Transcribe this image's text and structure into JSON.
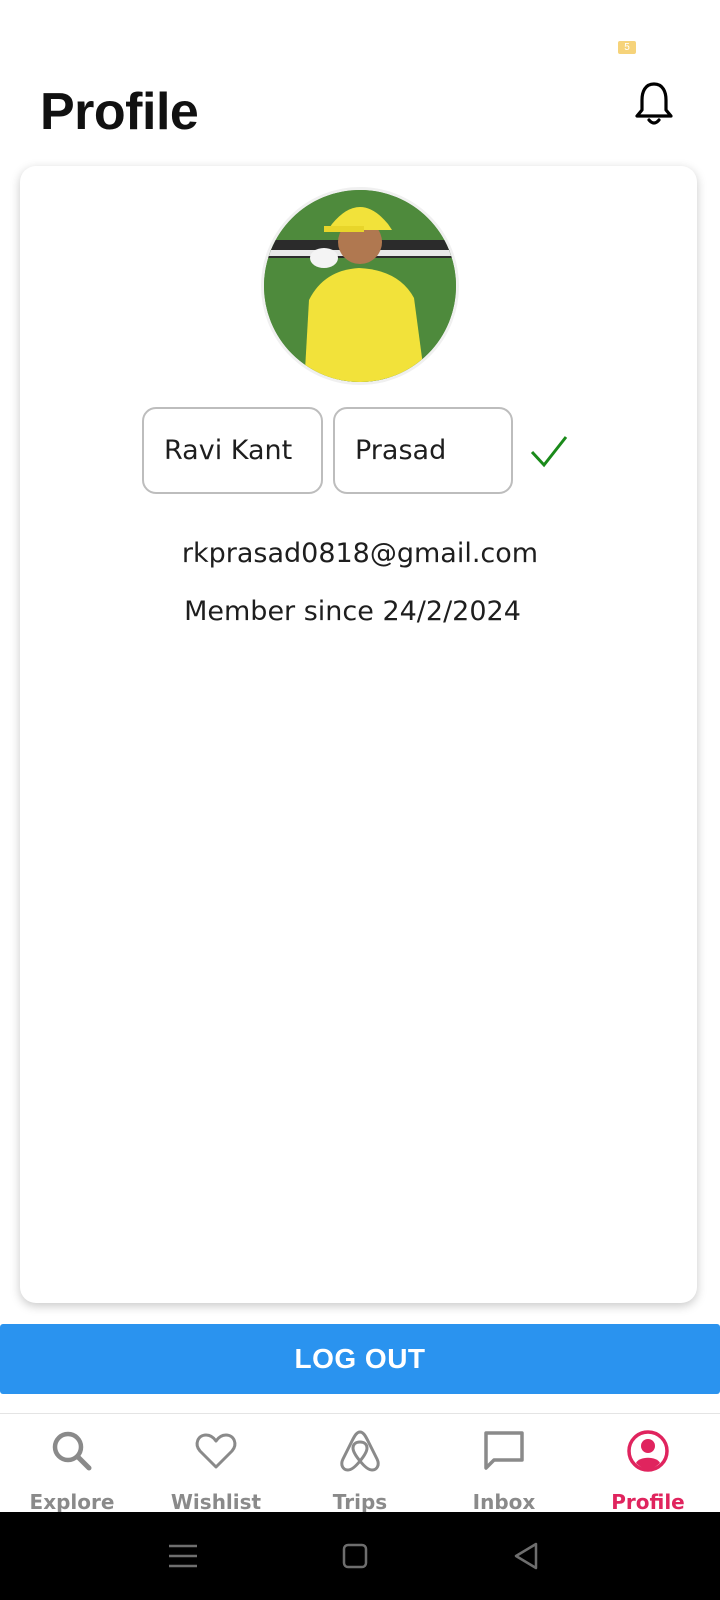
{
  "status_bar": {
    "indicator": "5"
  },
  "header": {
    "title": "Profile"
  },
  "profile": {
    "first_name": "Ravi Kant",
    "last_name": "Prasad",
    "email": "rkprasad0818@gmail.com",
    "member_since": "Member since 24/2/2024"
  },
  "actions": {
    "logout_label": "LOG OUT"
  },
  "nav": {
    "items": [
      {
        "label": "Explore",
        "icon": "search-icon"
      },
      {
        "label": "Wishlist",
        "icon": "heart-icon"
      },
      {
        "label": "Trips",
        "icon": "airbnb-logo-icon"
      },
      {
        "label": "Inbox",
        "icon": "chat-icon"
      },
      {
        "label": "Profile",
        "icon": "user-circle-icon"
      }
    ],
    "active": "Profile"
  },
  "colors": {
    "accent": "#e0245e",
    "primary_button": "#2a93ef",
    "check": "#1a8a1a",
    "muted": "#8a8a8a"
  }
}
